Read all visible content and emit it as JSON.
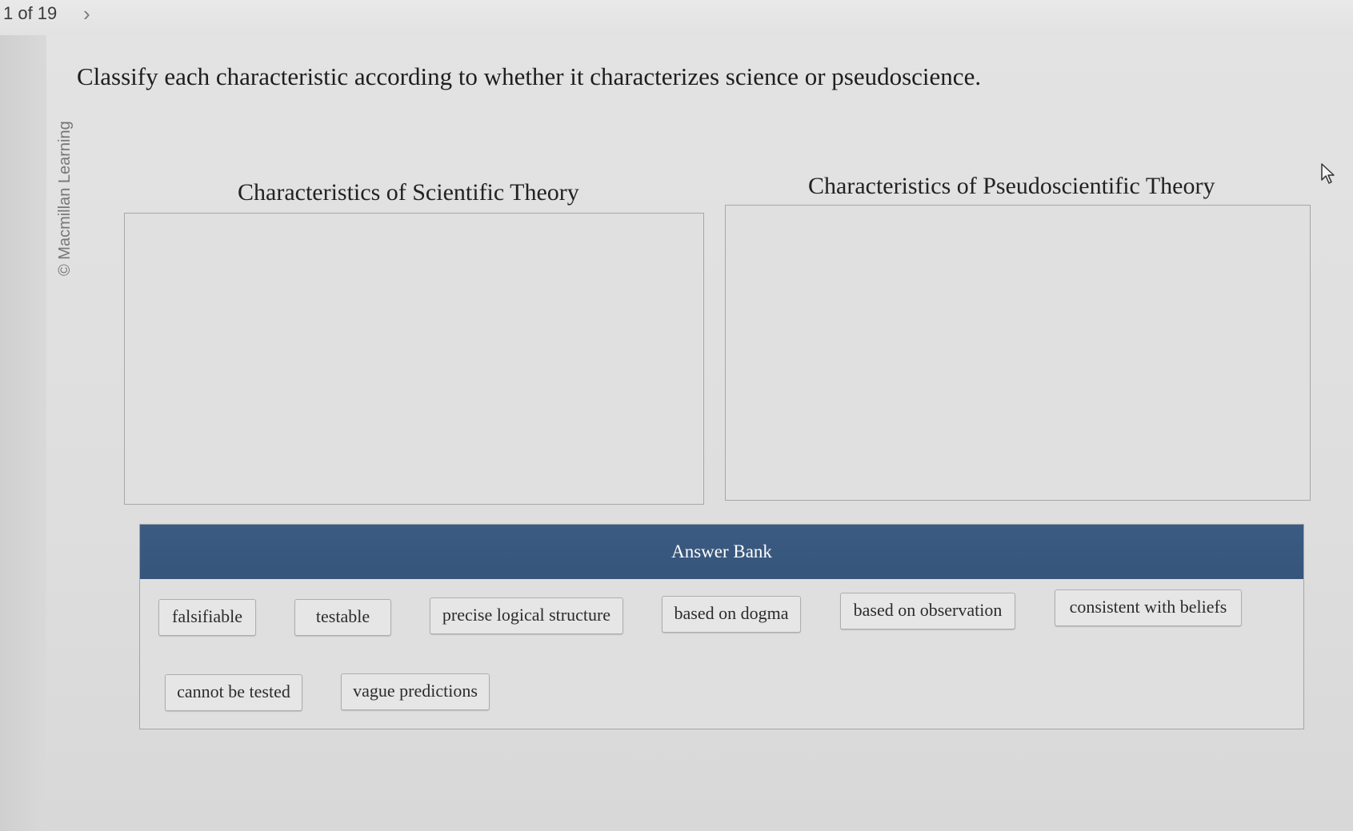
{
  "nav": {
    "page_counter": "1 of 19",
    "next_glyph": "›"
  },
  "sidebar": {
    "copyright": "© Macmillan Learning"
  },
  "question": {
    "prompt": "Classify each characteristic according to whether it characterizes science or pseudoscience."
  },
  "zones": [
    {
      "title": "Characteristics of Scientific Theory"
    },
    {
      "title": "Characteristics of Pseudoscientific Theory"
    }
  ],
  "answer_bank": {
    "title": "Answer Bank",
    "items": [
      "falsifiable",
      "testable",
      "precise logical structure",
      "based on dogma",
      "based on observation",
      "consistent with beliefs",
      "cannot be tested",
      "vague predictions"
    ]
  },
  "colors": {
    "bank_header": "#3c5b82",
    "zone_border": "#a7a7a7"
  },
  "icons": [
    "next-chevron-icon",
    "mouse-pointer-icon"
  ]
}
